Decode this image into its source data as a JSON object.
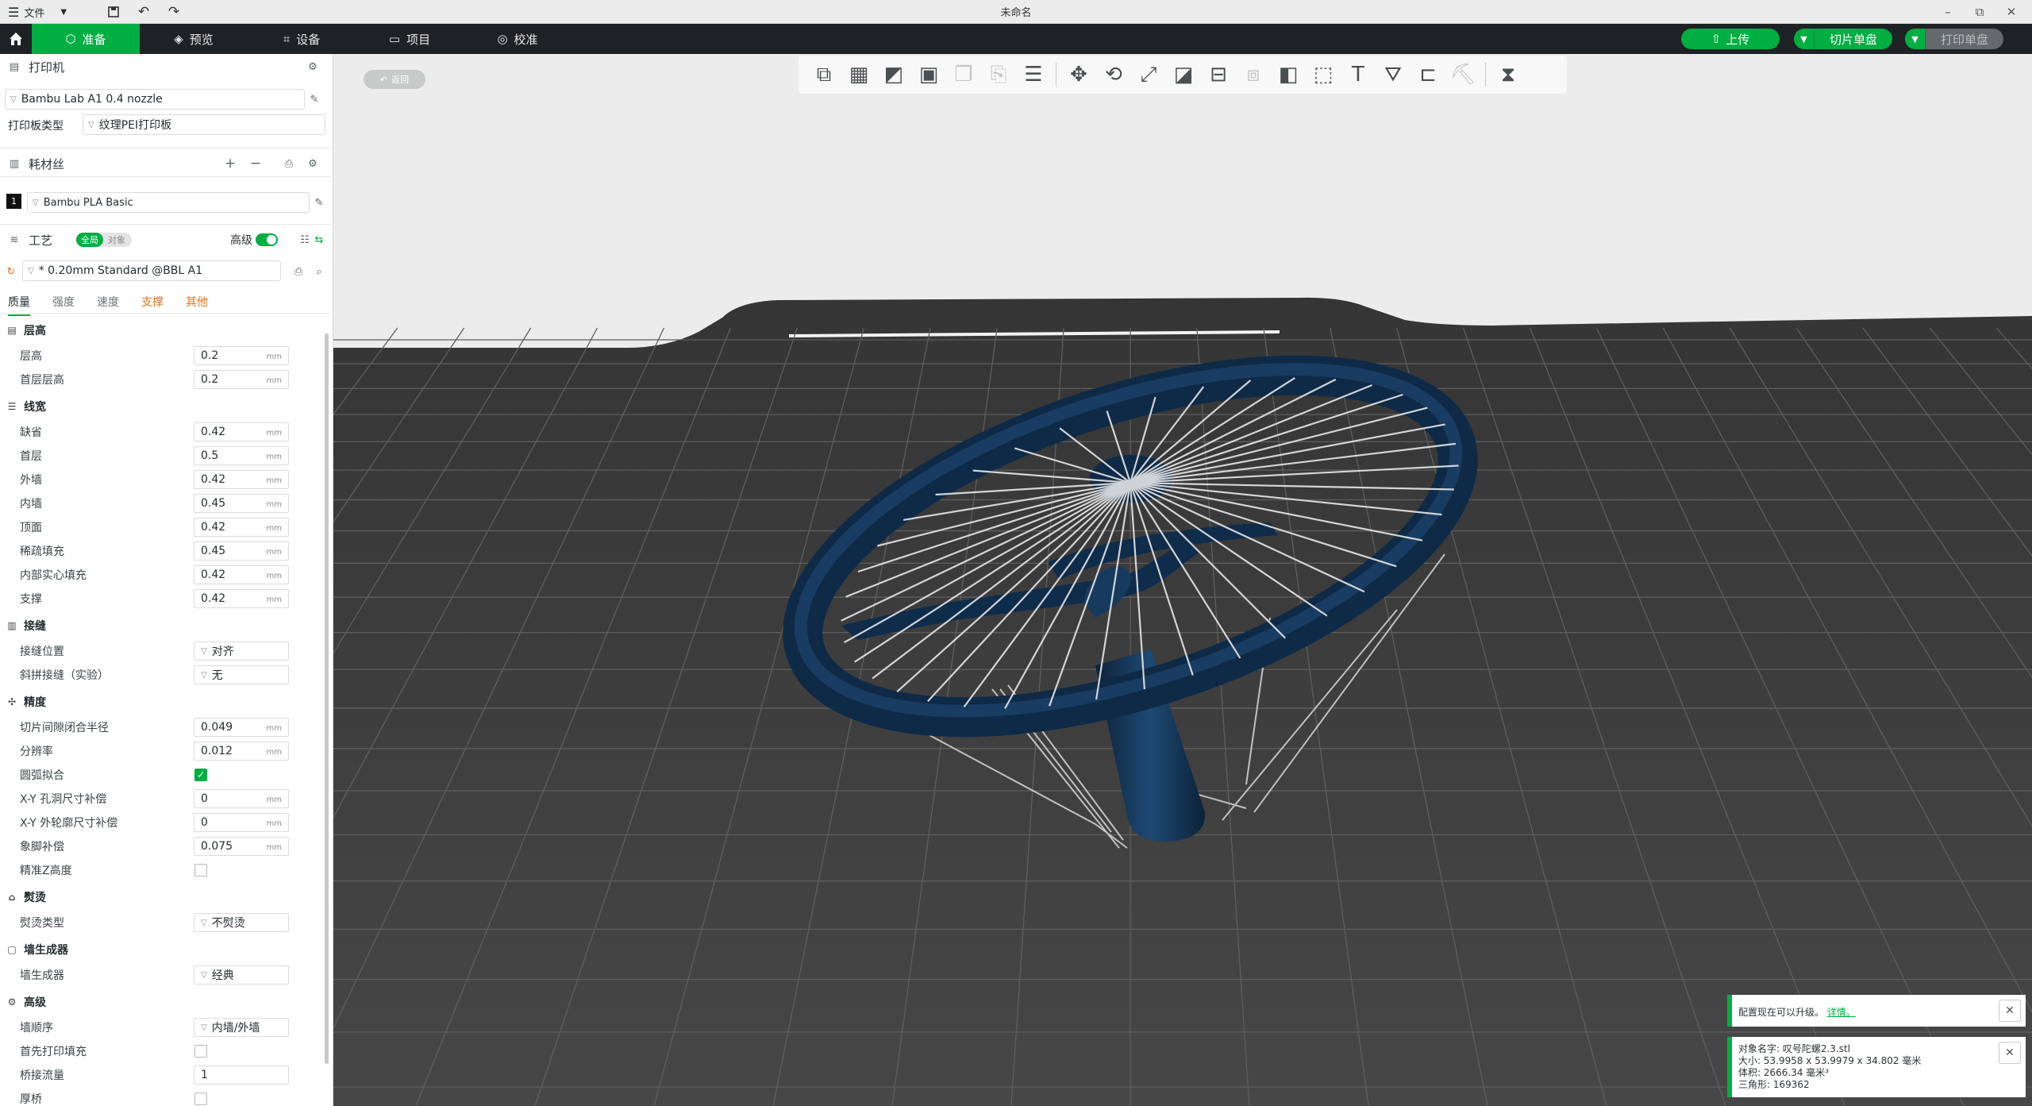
{
  "titlebar": {
    "menu_label": "文件",
    "title": "未命名",
    "minimize": "–",
    "restore": "⧉",
    "close": "✕"
  },
  "topbar": {
    "tabs": [
      {
        "label": "准备",
        "icon": "cube-icon"
      },
      {
        "label": "预览",
        "icon": "layers-icon"
      },
      {
        "label": "设备",
        "icon": "device-icon"
      },
      {
        "label": "项目",
        "icon": "project-icon"
      },
      {
        "label": "校准",
        "icon": "calibrate-icon"
      }
    ],
    "upload_label": "上传",
    "slice_label": "切片单盘",
    "print_label": "打印单盘"
  },
  "printer": {
    "section_label": "打印机",
    "name": "Bambu Lab A1 0.4 nozzle",
    "plate_label": "打印板类型",
    "plate_value": "纹理PEI打印板"
  },
  "filament": {
    "section_label": "耗材丝",
    "slot": "1",
    "name": "Bambu PLA Basic"
  },
  "process": {
    "section_label": "工艺",
    "toggle_global": "全局",
    "toggle_object": "对象",
    "advanced_label": "高级",
    "preset": "* 0.20mm Standard @BBL A1",
    "tabs": [
      "质量",
      "强度",
      "速度",
      "支撑",
      "其他"
    ]
  },
  "groups": {
    "layer_height": {
      "title": "层高",
      "items": [
        {
          "label": "层高",
          "value": "0.2",
          "unit": "mm"
        },
        {
          "label": "首层层高",
          "value": "0.2",
          "unit": "mm"
        }
      ]
    },
    "line_width": {
      "title": "线宽",
      "items": [
        {
          "label": "缺省",
          "value": "0.42",
          "unit": "mm"
        },
        {
          "label": "首层",
          "value": "0.5",
          "unit": "mm"
        },
        {
          "label": "外墙",
          "value": "0.42",
          "unit": "mm"
        },
        {
          "label": "内墙",
          "value": "0.45",
          "unit": "mm"
        },
        {
          "label": "顶面",
          "value": "0.42",
          "unit": "mm"
        },
        {
          "label": "稀疏填充",
          "value": "0.45",
          "unit": "mm"
        },
        {
          "label": "内部实心填充",
          "value": "0.42",
          "unit": "mm"
        },
        {
          "label": "支撑",
          "value": "0.42",
          "unit": "mm"
        }
      ]
    },
    "seam": {
      "title": "接缝",
      "items": [
        {
          "label": "接缝位置",
          "value": "对齐"
        },
        {
          "label": "斜拼接缝（实验）",
          "value": "无"
        }
      ]
    },
    "precision": {
      "title": "精度",
      "items": [
        {
          "label": "切片间隙闭合半径",
          "value": "0.049",
          "unit": "mm"
        },
        {
          "label": "分辨率",
          "value": "0.012",
          "unit": "mm"
        },
        {
          "label": "圆弧拟合",
          "checked": true
        },
        {
          "label": "X-Y 孔洞尺寸补偿",
          "value": "0",
          "unit": "mm"
        },
        {
          "label": "X-Y 外轮廓尺寸补偿",
          "value": "0",
          "unit": "mm"
        },
        {
          "label": "象脚补偿",
          "value": "0.075",
          "unit": "mm"
        },
        {
          "label": "精准Z高度",
          "checked": false
        }
      ]
    },
    "ironing": {
      "title": "熨烫",
      "items": [
        {
          "label": "熨烫类型",
          "value": "不熨烫"
        }
      ]
    },
    "wall_generator": {
      "title": "墙生成器",
      "items": [
        {
          "label": "墙生成器",
          "value": "经典"
        }
      ]
    },
    "advanced": {
      "title": "高级",
      "items": [
        {
          "label": "墙顺序",
          "value": "内墙/外墙"
        },
        {
          "label": "首先打印填充",
          "checked": false
        },
        {
          "label": "桥接流量",
          "value": "1"
        },
        {
          "label": "厚桥",
          "checked": false
        }
      ]
    }
  },
  "viewport": {
    "undo_label": "返回"
  },
  "notifications": {
    "upgrade_text": "配置现在可以升级。",
    "upgrade_link": "详情。",
    "object_name": "对象名字:  叹号陀螺2.3.stl",
    "size": "大小:    53.9958 x 53.9979 x 34.802 毫米",
    "volume": "体积:    2666.34 毫米³",
    "triangles": "三角形:  169362"
  },
  "colors": {
    "accent": "#00ae42",
    "topbar": "#1e2224",
    "bed": "#3b3b3b",
    "model": "#12314f"
  }
}
